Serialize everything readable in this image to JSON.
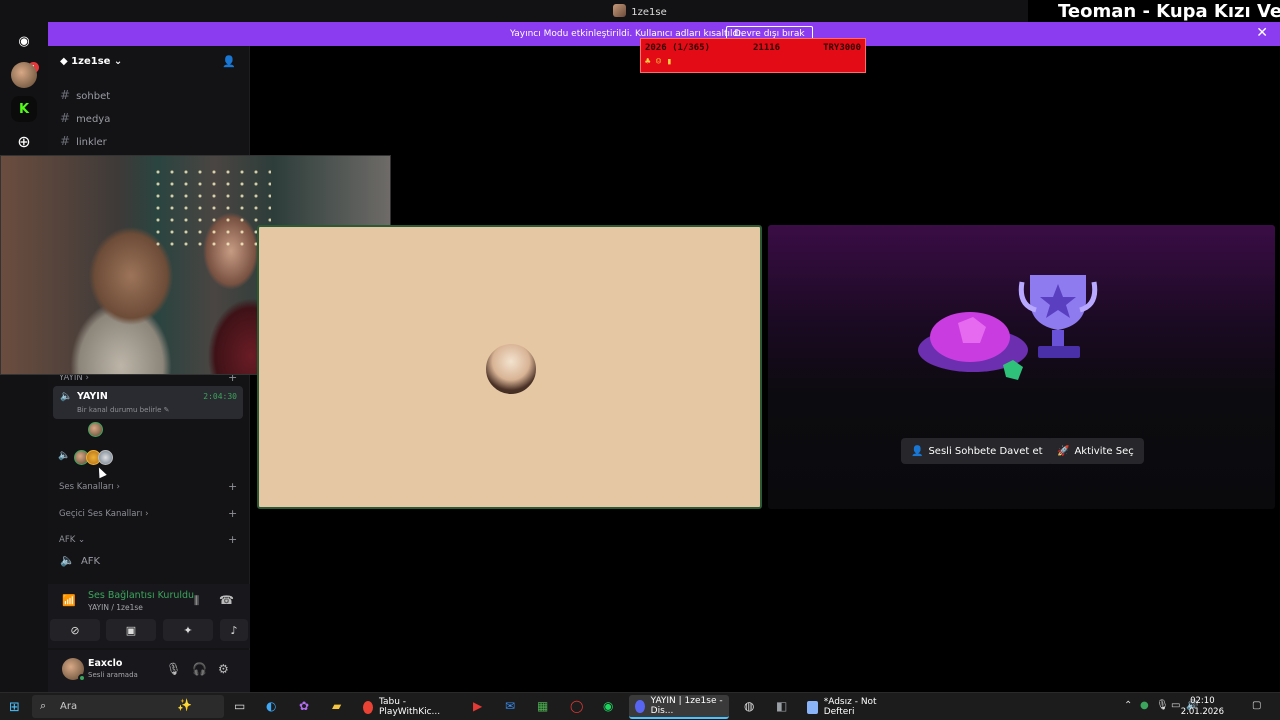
{
  "window": {
    "title": "1ze1se",
    "overlay_title": "Teoman - Kupa Kızı Ve Sinek"
  },
  "banner": {
    "text": "Yayıncı Modu etkinleştirildi. Kullanıcı adları kısaltıldı.",
    "button": "Devre dışı bırak"
  },
  "red_widget": {
    "left": "2026 (1/365)",
    "mid": "21116",
    "right": "TRY3000"
  },
  "rail": {
    "badge": "1"
  },
  "sidebar": {
    "server_name": "1ze1se",
    "channels": [
      {
        "label": "sohbet"
      },
      {
        "label": "medya"
      },
      {
        "label": "linkler"
      }
    ],
    "category_yayin": "YAYIN",
    "voice_channel": {
      "name": "YAYIN",
      "status": "Bir kanal durumu belirle",
      "time": "2:04:30"
    },
    "categories": [
      {
        "label": "Ses Kanalları"
      },
      {
        "label": "Geçici Ses Kanalları"
      },
      {
        "label": "AFK"
      }
    ],
    "afk_channel": "AFK"
  },
  "voice_panel": {
    "title": "Ses Bağlantısı Kuruldu",
    "subtitle": "YAYIN / 1ze1se"
  },
  "user_panel": {
    "name": "Eaxclo",
    "status": "Sesli aramada"
  },
  "stage": {
    "invite_button": "Sesli Sohbete Davet et",
    "activity_button": "Aktivite Seç"
  },
  "taskbar": {
    "search_placeholder": "Ara",
    "apps": [
      {
        "label": "Tabu - PlayWithKic...",
        "color": "#ea4335"
      },
      {
        "label": "YAYIN | 1ze1se - Dis...",
        "color": "#5865f2"
      },
      {
        "label": "*Adsız - Not Defteri",
        "color": "#8ab4f8"
      }
    ],
    "time": "02:10",
    "date": "2.01.2026"
  },
  "colors": {
    "banner": "#8b3cf0",
    "online": "#3ba55d",
    "accent": "#4cc2ff"
  }
}
